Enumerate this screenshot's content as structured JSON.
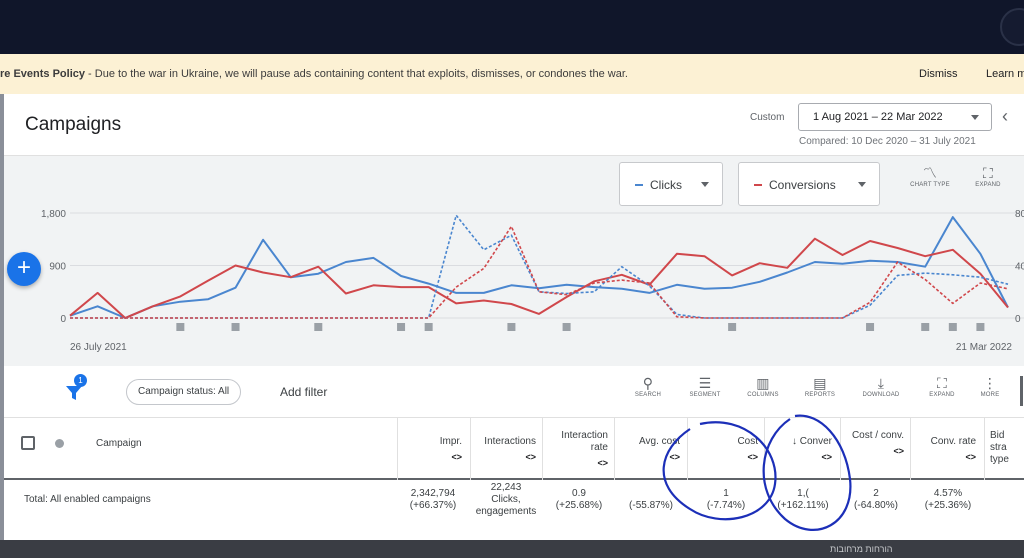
{
  "banner": {
    "message_bold": "re Events Policy",
    "message": " - Due to the war in Ukraine, we will pause ads containing content that exploits, dismisses, or condones the war.",
    "dismiss_label": "Dismiss",
    "learn_label": "Learn m"
  },
  "header": {
    "title": "Campaigns",
    "custom_label": "Custom",
    "date_range": "1 Aug 2021 – 22 Mar 2022",
    "compared": "Compared: 10 Dec 2020 – 31 July 2021"
  },
  "chart_controls": {
    "metric1": "Clicks",
    "metric2": "Conversions",
    "chart_type_label": "CHART TYPE",
    "expand_label": "EXPAND"
  },
  "chart_data": {
    "type": "line",
    "x_start_label": "26 July 2021",
    "x_end_label": "21 Mar 2022",
    "y_ticks": [
      "1,800",
      "900",
      "0"
    ],
    "y_right_ticks": [
      "80",
      "40",
      "0"
    ],
    "ylim": [
      0,
      1800
    ],
    "colors": {
      "clicks": "#4a86cf",
      "conversions": "#d0474b"
    },
    "series": [
      {
        "key": "clicks",
        "dashed": false,
        "values": [
          40,
          200,
          0,
          200,
          280,
          320,
          520,
          1340,
          700,
          760,
          960,
          1030,
          720,
          590,
          430,
          430,
          560,
          510,
          570,
          530,
          500,
          430,
          570,
          500,
          520,
          620,
          780,
          960,
          930,
          980,
          960,
          880,
          1730,
          1100,
          180
        ]
      },
      {
        "key": "conversions",
        "dashed": false,
        "values": [
          40,
          430,
          0,
          200,
          370,
          640,
          900,
          780,
          700,
          880,
          420,
          560,
          530,
          530,
          250,
          300,
          240,
          70,
          360,
          630,
          740,
          570,
          1100,
          1060,
          730,
          940,
          860,
          1360,
          1080,
          1320,
          1200,
          1060,
          1170,
          760,
          180
        ]
      },
      {
        "key": "clicks",
        "dashed": true,
        "values": [
          0,
          0,
          0,
          0,
          0,
          0,
          0,
          0,
          0,
          0,
          0,
          0,
          0,
          0,
          1760,
          1170,
          1420,
          450,
          420,
          450,
          880,
          550,
          60,
          0,
          0,
          0,
          0,
          0,
          0,
          220,
          730,
          770,
          740,
          700,
          580
        ]
      },
      {
        "key": "conversions",
        "dashed": true,
        "values": [
          0,
          0,
          0,
          0,
          0,
          0,
          0,
          0,
          0,
          0,
          0,
          0,
          0,
          0,
          530,
          850,
          1570,
          450,
          400,
          600,
          650,
          600,
          20,
          0,
          0,
          0,
          0,
          0,
          0,
          270,
          960,
          660,
          250,
          600,
          500
        ]
      }
    ],
    "markers_at": [
      4,
      6,
      9,
      12,
      13,
      16,
      18,
      24,
      29,
      31,
      32,
      33
    ]
  },
  "toolbar": {
    "status_chip": "Campaign status: All",
    "add_filter": "Add filter",
    "filter_badge": "1",
    "search": "SEARCH",
    "segment": "SEGMENT",
    "columns": "COLUMNS",
    "reports": "REPORTS",
    "download": "DOWNLOAD",
    "expand": "EXPAND",
    "more": "MORE"
  },
  "table": {
    "headers": {
      "campaign": "Campaign",
      "impr": "Impr.",
      "interactions": "Interactions",
      "interaction_rate": "Interaction rate",
      "avg_cost": "Avg. cost",
      "cost": "Cost",
      "conversions": "↓ Conver",
      "cost_conv": "Cost / conv.",
      "conv_rate": "Conv. rate",
      "bid_strategy": "Bid stra type",
      "arrows": "<>"
    },
    "total": {
      "label": "Total: All enabled campaigns",
      "impr": "2,342,794",
      "impr_change": "(+66.37%)",
      "interactions": "22,243",
      "interactions_unit": "Clicks,",
      "interactions_sub": "engagements",
      "interaction_rate": "0.9",
      "interaction_rate_change": "(+25.68%)",
      "avg_cost_change": "(-55.87%)",
      "cost_partial": "1",
      "cost_change": "(-7.74%)",
      "conversions_partial": "1,(",
      "conversions_change": "(+162.11%)",
      "cost_conv_partial": "2",
      "cost_conv_change": "(-64.80%)",
      "conv_rate": "4.57%",
      "conv_rate_change": "(+25.36%)"
    }
  },
  "footer": {
    "hebrew_text": "הורחות מרחובות"
  }
}
